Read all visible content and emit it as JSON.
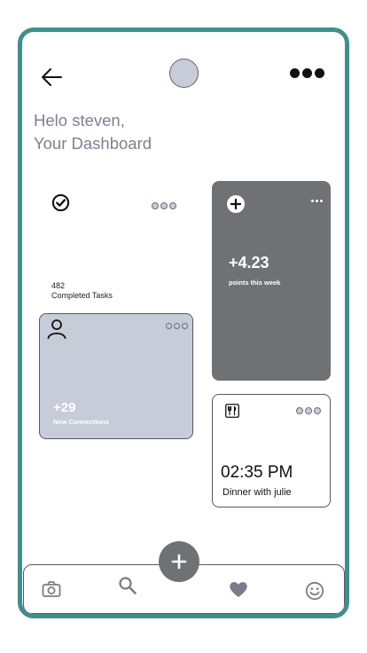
{
  "header": {
    "back_icon": "arrow-left-icon",
    "more_icon": "more-horizontal-icon"
  },
  "greeting": {
    "line1": "Helo steven,",
    "line2": "Your Dashboard"
  },
  "cards": {
    "tasks": {
      "icon": "check-circle-icon",
      "value": "482",
      "label": "Completed Tasks"
    },
    "points": {
      "icon": "plus-circle-icon",
      "value": "+4.23",
      "label": "points this week"
    },
    "connections": {
      "icon": "person-icon",
      "value": "+29",
      "label": "New Connections"
    },
    "dinner": {
      "icon": "fork-knife-icon",
      "time": "02:35 PM",
      "label": "Dinner with julie"
    }
  },
  "bottom_nav": {
    "items": [
      "camera-icon",
      "search-icon",
      "heart-icon",
      "smiley-icon"
    ],
    "fab_icon": "plus-icon"
  },
  "colors": {
    "frame": "#3f8f8b",
    "dark_card": "#6f7174",
    "light_card": "#c7ccd8",
    "greeting_text": "#7d7f94"
  }
}
